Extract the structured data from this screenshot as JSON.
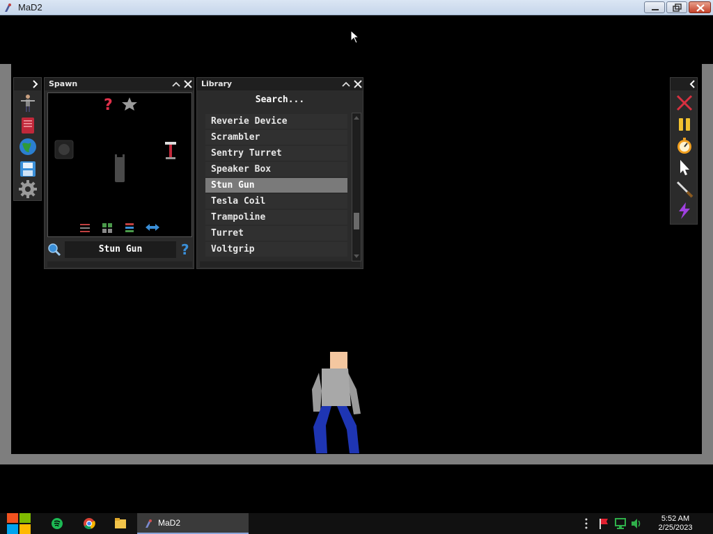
{
  "window": {
    "title": "MaD2"
  },
  "spawn": {
    "title": "Spawn",
    "selected_item": "Stun Gun"
  },
  "library": {
    "title": "Library",
    "search_placeholder": "Search...",
    "items": [
      {
        "label": "Reverie Device"
      },
      {
        "label": "Scrambler"
      },
      {
        "label": "Sentry Turret"
      },
      {
        "label": "Speaker Box"
      },
      {
        "label": "Stun Gun",
        "selected": true
      },
      {
        "label": "Tesla Coil"
      },
      {
        "label": "Trampoline"
      },
      {
        "label": "Turret"
      },
      {
        "label": "Voltgrip"
      }
    ]
  },
  "left_toolbar": {
    "icons": [
      "person-icon",
      "book-icon",
      "globe-icon",
      "save-icon",
      "gear-icon"
    ]
  },
  "right_toolbar": {
    "icons": [
      "clear-x-icon",
      "pause-icon",
      "stopwatch-icon",
      "pointer-icon",
      "knife-icon",
      "lightning-icon"
    ]
  },
  "taskbar": {
    "app_label": "MaD2",
    "time": "5:52 AM",
    "date": "2/25/2023"
  },
  "colors": {
    "wall": "#7e7e7e",
    "selected_row": "#7a7a7a",
    "player_shirt": "#a8a8a8",
    "player_pants": "#1e35b3",
    "player_skin": "#f4c7a0"
  }
}
